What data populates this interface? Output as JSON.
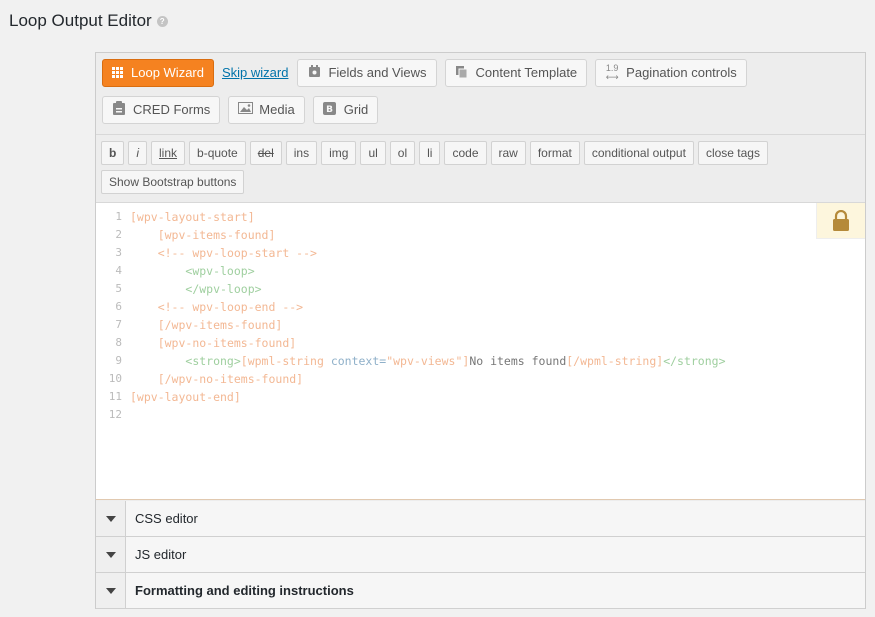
{
  "page": {
    "title": "Loop Output Editor",
    "help_glyph": "?"
  },
  "toolbar": {
    "loop_wizard": "Loop Wizard",
    "skip_wizard": "Skip wizard",
    "fields_views": "Fields and Views",
    "content_template": "Content Template",
    "pagination": "Pagination controls",
    "cred_forms": "CRED Forms",
    "media": "Media",
    "grid": "Grid"
  },
  "quicktags": {
    "row1": [
      "b",
      "i",
      "link",
      "b-quote",
      "del",
      "ins",
      "img",
      "ul",
      "ol",
      "li",
      "code",
      "raw",
      "format",
      "conditional output",
      "close tags"
    ],
    "bootstrap": "Show Bootstrap buttons"
  },
  "editor": {
    "line_numbers": [
      "1",
      "2",
      "3",
      "4",
      "5",
      "6",
      "7",
      "8",
      "9",
      "10",
      "11",
      "12"
    ],
    "lines": [
      "[wpv-layout-start]",
      "    [wpv-items-found]",
      "    <!-- wpv-loop-start -->",
      "        <wpv-loop>",
      "        </wpv-loop>",
      "    <!-- wpv-loop-end -->",
      "    [/wpv-items-found]",
      "    [wpv-no-items-found]",
      "        <strong>[wpml-string context=\"wpv-views\"]No items found[/wpml-string]</strong>",
      "    [/wpv-no-items-found]",
      "[wpv-layout-end]",
      ""
    ]
  },
  "sections": {
    "css": "CSS editor",
    "js": "JS editor",
    "formatting": "Formatting and editing instructions"
  }
}
